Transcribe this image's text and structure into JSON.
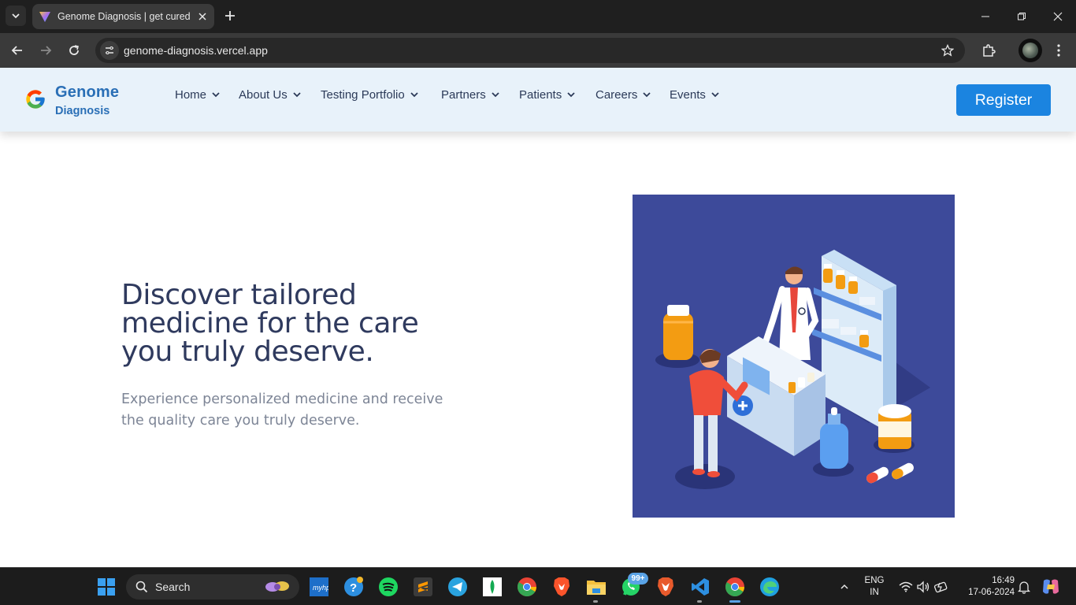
{
  "browser": {
    "tab_title": "Genome Diagnosis | get cured a",
    "url": "genome-diagnosis.vercel.app"
  },
  "site": {
    "brand_line1": "Genome",
    "brand_line2": "Diagnosis",
    "nav": [
      {
        "label": "Home"
      },
      {
        "label": "About Us"
      },
      {
        "label": "Testing Portfolio"
      },
      {
        "label": "Partners"
      },
      {
        "label": "Patients"
      },
      {
        "label": "Careers"
      },
      {
        "label": "Events"
      }
    ],
    "register_label": "Register"
  },
  "hero": {
    "title": "Discover tailored medicine for the care you truly deserve.",
    "subtitle": "Experience personalized medicine and receive the quality care you truly deserve.",
    "illustration_icon": "pharmacy-illustration",
    "illustration_bg": "#3d4a9a"
  },
  "taskbar": {
    "search_label": "Search",
    "whatsapp_badge": "99+",
    "lang_line1": "ENG",
    "lang_line2": "IN",
    "time": "16:49",
    "date": "17-06-2024"
  },
  "colors": {
    "accent": "#1b84e0",
    "brand": "#2a6fb6",
    "nav_bg": "#e8f2fa",
    "heading": "#2f3a5e"
  }
}
